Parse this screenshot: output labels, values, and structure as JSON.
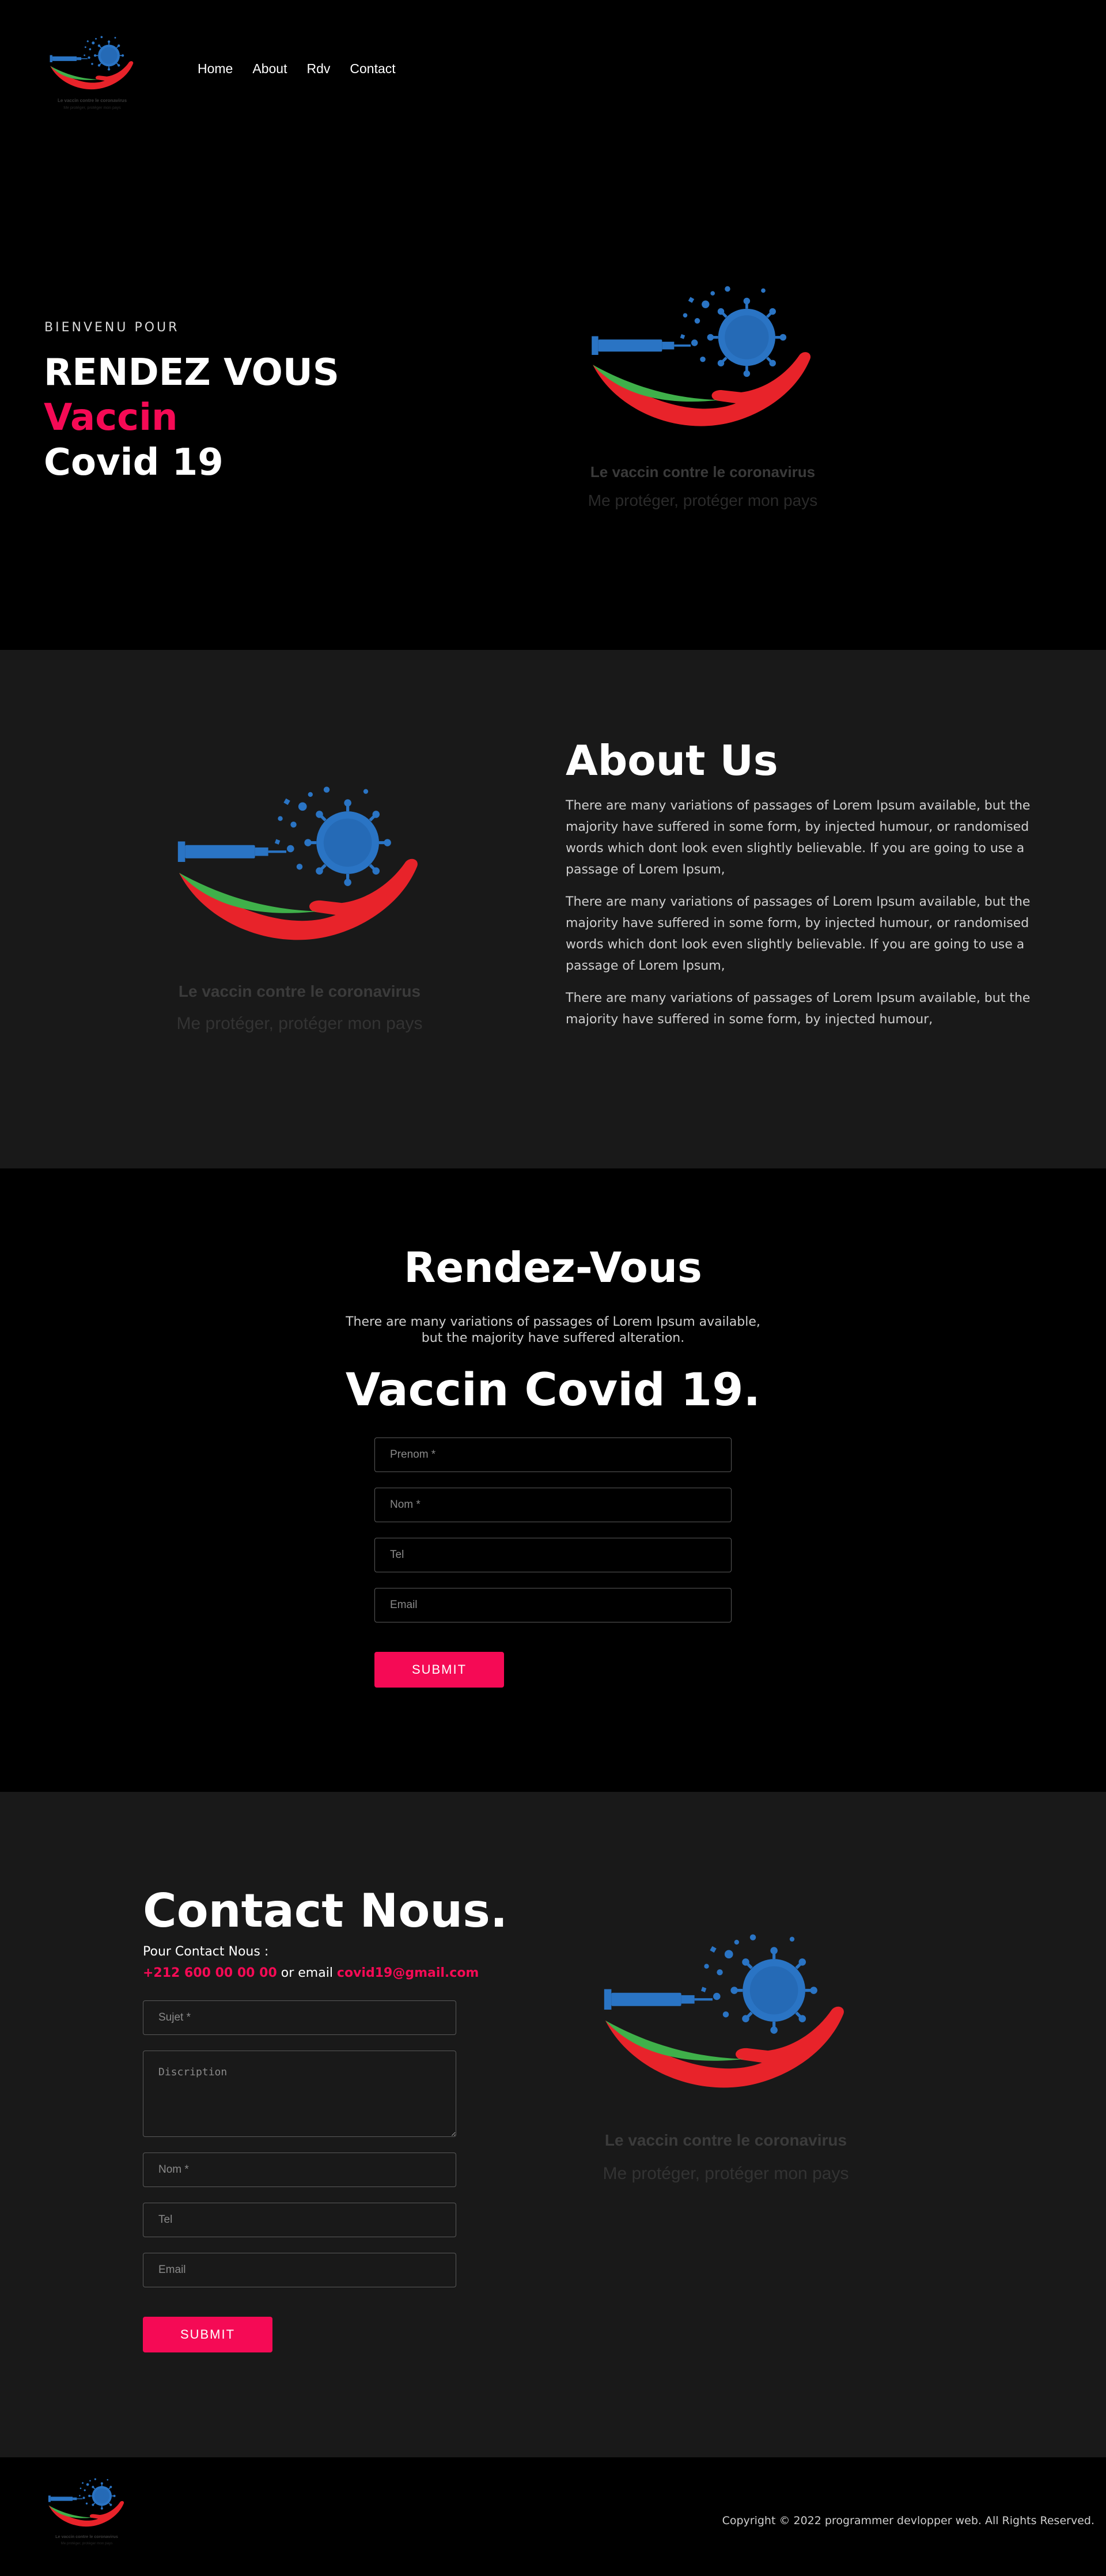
{
  "nav": {
    "logo_caption_1": "Le vaccin contre le coronavirus",
    "logo_caption_2": "Me protéger, protéger mon pays",
    "items": [
      {
        "label": "Home"
      },
      {
        "label": "About"
      },
      {
        "label": "Rdv"
      },
      {
        "label": "Contact"
      }
    ]
  },
  "hero": {
    "eyebrow": "BIENVENU POUR",
    "title_line1": "RENDEZ VOUS",
    "title_line2": "Vaccin",
    "title_line3": "Covid 19",
    "art_caption_1": "Le vaccin contre le coronavirus",
    "art_caption_2": "Me protéger, protéger mon pays"
  },
  "about": {
    "title": "About Us",
    "paragraphs": [
      "There are many variations of passages of Lorem Ipsum available, but the majority have suffered in some form, by injected humour, or randomised words which dont look even slightly believable. If you are going to use a passage of Lorem Ipsum,",
      "There are many variations of passages of Lorem Ipsum available, but the majority have suffered in some form, by injected humour, or randomised words which dont look even slightly believable. If you are going to use a passage of Lorem Ipsum,",
      "There are many variations of passages of Lorem Ipsum available, but the majority have suffered in some form, by injected humour,"
    ],
    "art_caption_1": "Le vaccin contre le coronavirus",
    "art_caption_2": "Me protéger, protéger mon pays"
  },
  "rdv": {
    "title": "Rendez-Vous",
    "lead_line1": "There are many variations of passages of Lorem Ipsum available,",
    "lead_line2": "but the majority have suffered alteration.",
    "subtitle": "Vaccin Covid 19.",
    "fields": {
      "prenom": "Prenom *",
      "nom": "Nom *",
      "tel": "Tel",
      "email": "Email"
    },
    "submit_label": "SUBMIT"
  },
  "contact": {
    "title": "Contact Nous.",
    "pour": "Pour Contact Nous :",
    "phone": "+212 600 00 00 00",
    "or_email": " or email ",
    "email": "covid19@gmail.com",
    "fields": {
      "sujet": "Sujet *",
      "discription": "Discription",
      "nom": "Nom *",
      "tel": "Tel",
      "email": "Email"
    },
    "submit_label": "SUBMIT",
    "art_caption_1": "Le vaccin contre le coronavirus",
    "art_caption_2": "Me protéger, protéger mon pays"
  },
  "footer": {
    "copyright": "Copyright © 2022 programmer devlopper web. All Rights Reserved.",
    "logo_caption_1": "Le vaccin contre le coronavirus",
    "logo_caption_2": "Me protéger, protéger mon pays"
  },
  "colors": {
    "accent": "#f50a55",
    "page_bg": "#000000",
    "section_alt_bg": "#191919",
    "vaccine_blue": "#2a74c4",
    "hand_red": "#e8232a",
    "hand_green": "#3fb04a"
  }
}
